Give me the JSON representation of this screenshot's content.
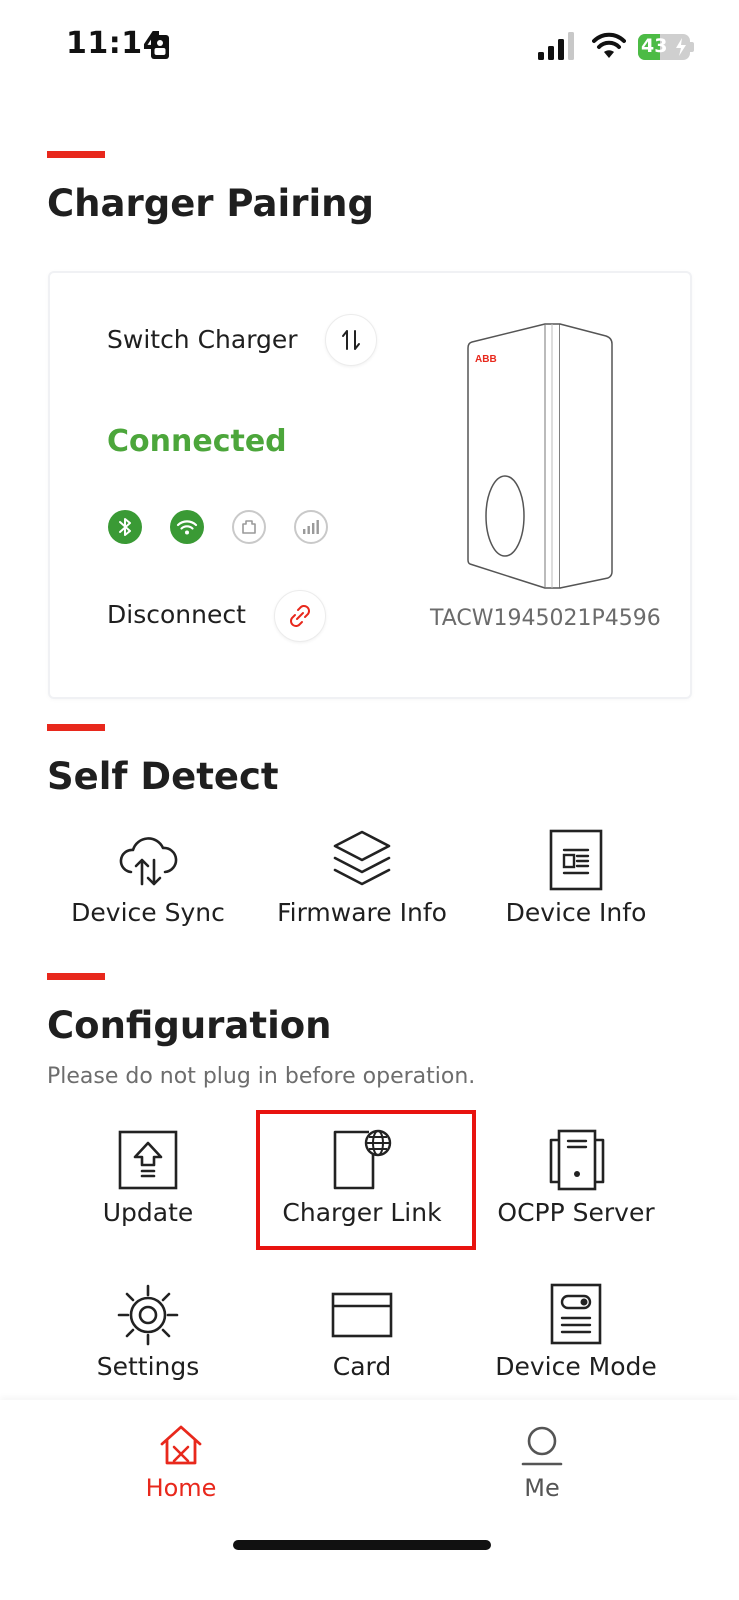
{
  "status_bar": {
    "time": "11:14",
    "battery": "43",
    "battery_level_percent": 43,
    "icons": [
      "sim-card-icon",
      "signal-icon",
      "wifi-icon",
      "battery-charging-icon"
    ]
  },
  "pairing": {
    "title": "Charger Pairing",
    "switch_label": "Switch Charger",
    "status": "Connected",
    "disconnect_label": "Disconnect",
    "serial": "TACW1945021P4596",
    "charger_brand_mark": "ABB",
    "connectivity": [
      {
        "name": "bluetooth",
        "active": true
      },
      {
        "name": "wifi",
        "active": true
      },
      {
        "name": "ethernet",
        "active": false
      },
      {
        "name": "cellular",
        "active": false
      }
    ]
  },
  "self_detect": {
    "title": "Self Detect",
    "items": [
      {
        "label": "Device Sync",
        "icon": "cloud-sync-icon"
      },
      {
        "label": "Firmware Info",
        "icon": "layers-icon"
      },
      {
        "label": "Device Info",
        "icon": "document-icon"
      }
    ]
  },
  "configuration": {
    "title": "Configuration",
    "subtitle": "Please do not plug in before operation.",
    "items": [
      {
        "label": "Update",
        "icon": "upload-icon"
      },
      {
        "label": "Charger Link",
        "icon": "globe-link-icon",
        "highlighted": true
      },
      {
        "label": "OCPP Server",
        "icon": "server-icon"
      },
      {
        "label": "Settings",
        "icon": "gear-icon"
      },
      {
        "label": "Card",
        "icon": "card-icon"
      },
      {
        "label": "Device Mode",
        "icon": "device-mode-icon"
      }
    ]
  },
  "bottom_nav": {
    "items": [
      {
        "label": "Home",
        "active": true
      },
      {
        "label": "Me",
        "active": false
      }
    ]
  },
  "colors": {
    "accent": "#e8281c",
    "connected_green": "#4ca63b",
    "highlight_box": "#e8130f",
    "text": "#1f1f1f"
  }
}
